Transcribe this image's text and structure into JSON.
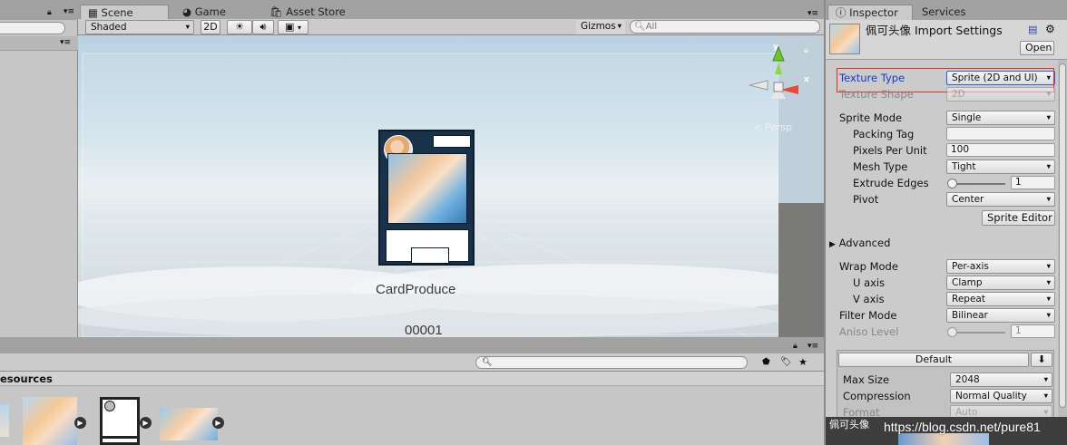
{
  "tabs": {
    "scene": "Scene",
    "game": "Game",
    "asset_store": "Asset Store",
    "inspector": "Inspector",
    "services": "Services"
  },
  "scene_toolbar": {
    "shading": "Shaded",
    "mode_2d": "2D",
    "gizmos": "Gizmos",
    "search_placeholder": "All"
  },
  "scene": {
    "persp": "Persp",
    "axis_x": "x",
    "axis_y": "y",
    "card_title": "CardProduce",
    "card_number": "00001"
  },
  "project": {
    "breadcrumb": "esources"
  },
  "inspector": {
    "title": "佩可头像 Import Settings",
    "open": "Open",
    "texture_type": {
      "label": "Texture Type",
      "value": "Sprite (2D and UI)"
    },
    "texture_shape": {
      "label": "Texture Shape",
      "value": "2D"
    },
    "sprite_mode": {
      "label": "Sprite Mode",
      "value": "Single"
    },
    "packing_tag": {
      "label": "Packing Tag",
      "value": ""
    },
    "pixels_per_unit": {
      "label": "Pixels Per Unit",
      "value": "100"
    },
    "mesh_type": {
      "label": "Mesh Type",
      "value": "Tight"
    },
    "extrude_edges": {
      "label": "Extrude Edges",
      "value": "1"
    },
    "pivot": {
      "label": "Pivot",
      "value": "Center"
    },
    "sprite_editor": "Sprite Editor",
    "advanced": "Advanced",
    "wrap_mode": {
      "label": "Wrap Mode",
      "value": "Per-axis"
    },
    "u_axis": {
      "label": "U axis",
      "value": "Clamp"
    },
    "v_axis": {
      "label": "V axis",
      "value": "Repeat"
    },
    "filter_mode": {
      "label": "Filter Mode",
      "value": "Bilinear"
    },
    "aniso_level": {
      "label": "Aniso Level",
      "value": "1"
    },
    "platform_tab": "Default",
    "max_size": {
      "label": "Max Size",
      "value": "2048"
    },
    "compression": {
      "label": "Compression",
      "value": "Normal Quality"
    },
    "format": {
      "label": "Format",
      "value": "Auto"
    },
    "preview_name": "佩可头像"
  },
  "watermark": "https://blog.csdn.net/pure81",
  "colors": {
    "highlight_box": "#e03030",
    "label_blue": "#1a38c8",
    "panel": "#cbcbcb"
  }
}
